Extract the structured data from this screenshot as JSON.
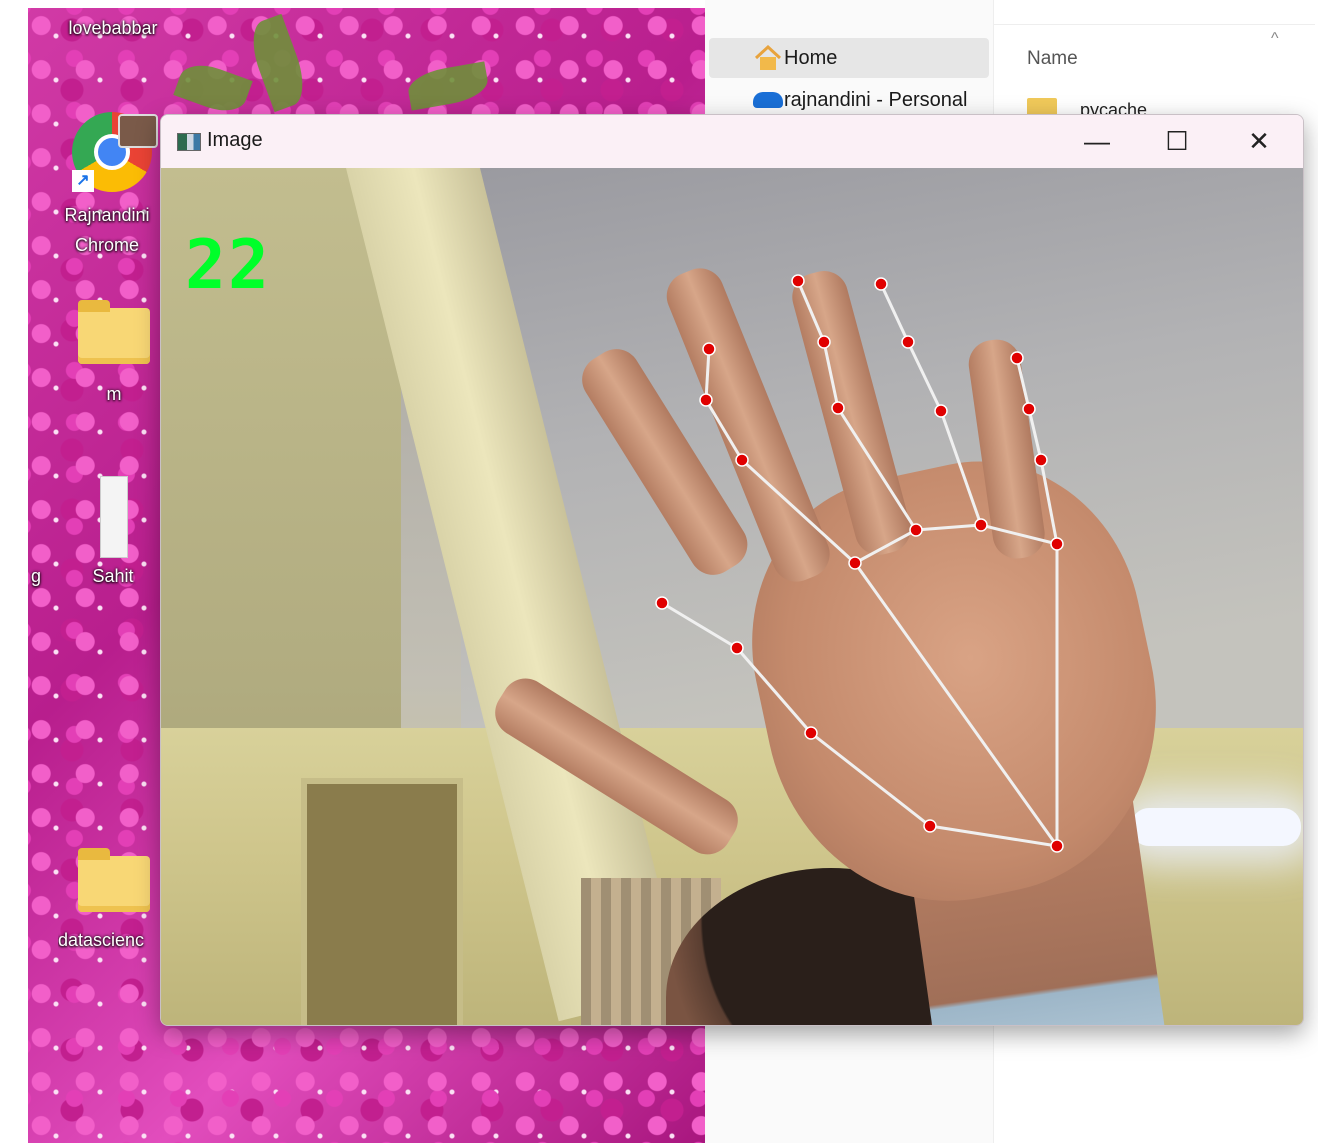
{
  "desktop": {
    "icons": [
      {
        "label": "lovebabbar"
      },
      {
        "label": "Rajnandini\nChrome"
      },
      {
        "label": "m"
      },
      {
        "label": "Sahit"
      },
      {
        "label": "g"
      },
      {
        "label": "datascienc"
      }
    ]
  },
  "explorer": {
    "nav_items": [
      {
        "label": "Home",
        "icon": "home-icon",
        "selected": true
      },
      {
        "label": "rajnandini - Personal",
        "icon": "onedrive-cloud-icon",
        "selected": false
      }
    ],
    "column_header": "Name",
    "partial_row": "pycache"
  },
  "image_window": {
    "title": "Image",
    "buttons": {
      "minimize": "—",
      "maximize": "☐",
      "close": "✕"
    },
    "overlay_counter": "22",
    "colors": {
      "counter": "#00ff2a",
      "landmark": "#e00000",
      "connection": "#f0f0f0"
    }
  }
}
